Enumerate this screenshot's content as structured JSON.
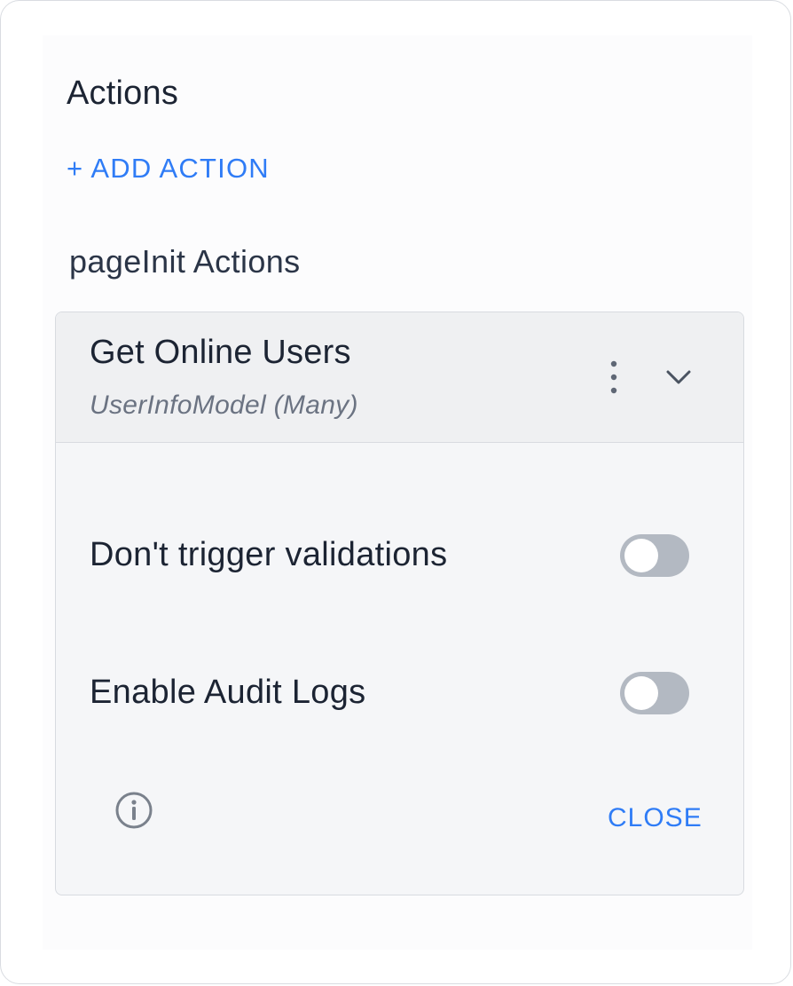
{
  "section": {
    "title": "Actions",
    "add_action_label": "+ ADD ACTION"
  },
  "group": {
    "title": "pageInit Actions"
  },
  "action_card": {
    "title": "Get Online Users",
    "subtitle": "UserInfoModel (Many)",
    "menu_icon": "kebab-vertical-icon",
    "expand_icon": "chevron-down-icon",
    "options": [
      {
        "label": "Don't trigger validations",
        "enabled": false
      },
      {
        "label": "Enable Audit Logs",
        "enabled": false
      }
    ],
    "info_icon": "info-circle-icon",
    "close_label": "CLOSE"
  },
  "colors": {
    "accent": "#2f7cf6",
    "text_primary": "#1c2433",
    "text_secondary": "#6b7382",
    "toggle_off": "#b3b9c2",
    "card_bg": "#f5f6f8",
    "header_bg": "#eff0f2"
  }
}
